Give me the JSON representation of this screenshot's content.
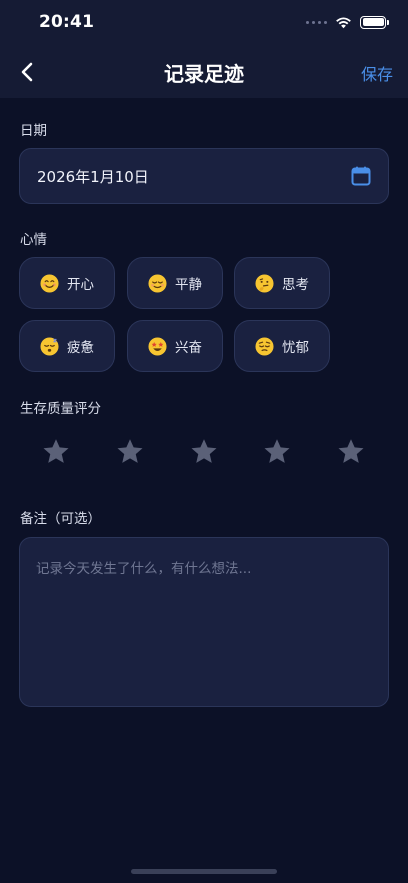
{
  "status_bar": {
    "time": "20:41"
  },
  "nav": {
    "title": "记录足迹",
    "save_label": "保存"
  },
  "date": {
    "label": "日期",
    "value": "2026年1月10日"
  },
  "mood": {
    "label": "心情",
    "options": [
      {
        "label": "开心",
        "icon": "smiling-face-icon"
      },
      {
        "label": "平静",
        "icon": "relieved-face-icon"
      },
      {
        "label": "思考",
        "icon": "thinking-face-icon"
      },
      {
        "label": "疲惫",
        "icon": "sleepy-face-icon"
      },
      {
        "label": "兴奋",
        "icon": "star-struck-face-icon"
      },
      {
        "label": "忧郁",
        "icon": "pensive-face-icon"
      }
    ]
  },
  "rating": {
    "label": "生存质量评分",
    "value": 0,
    "max": 5
  },
  "note": {
    "label": "备注（可选）",
    "placeholder": "记录今天发生了什么，有什么想法..."
  },
  "colors": {
    "background": "#0c1127",
    "card": "#1a2140",
    "accent": "#4a8fe8",
    "star_inactive": "#5b6178",
    "emoji_yellow": "#f7c531"
  }
}
